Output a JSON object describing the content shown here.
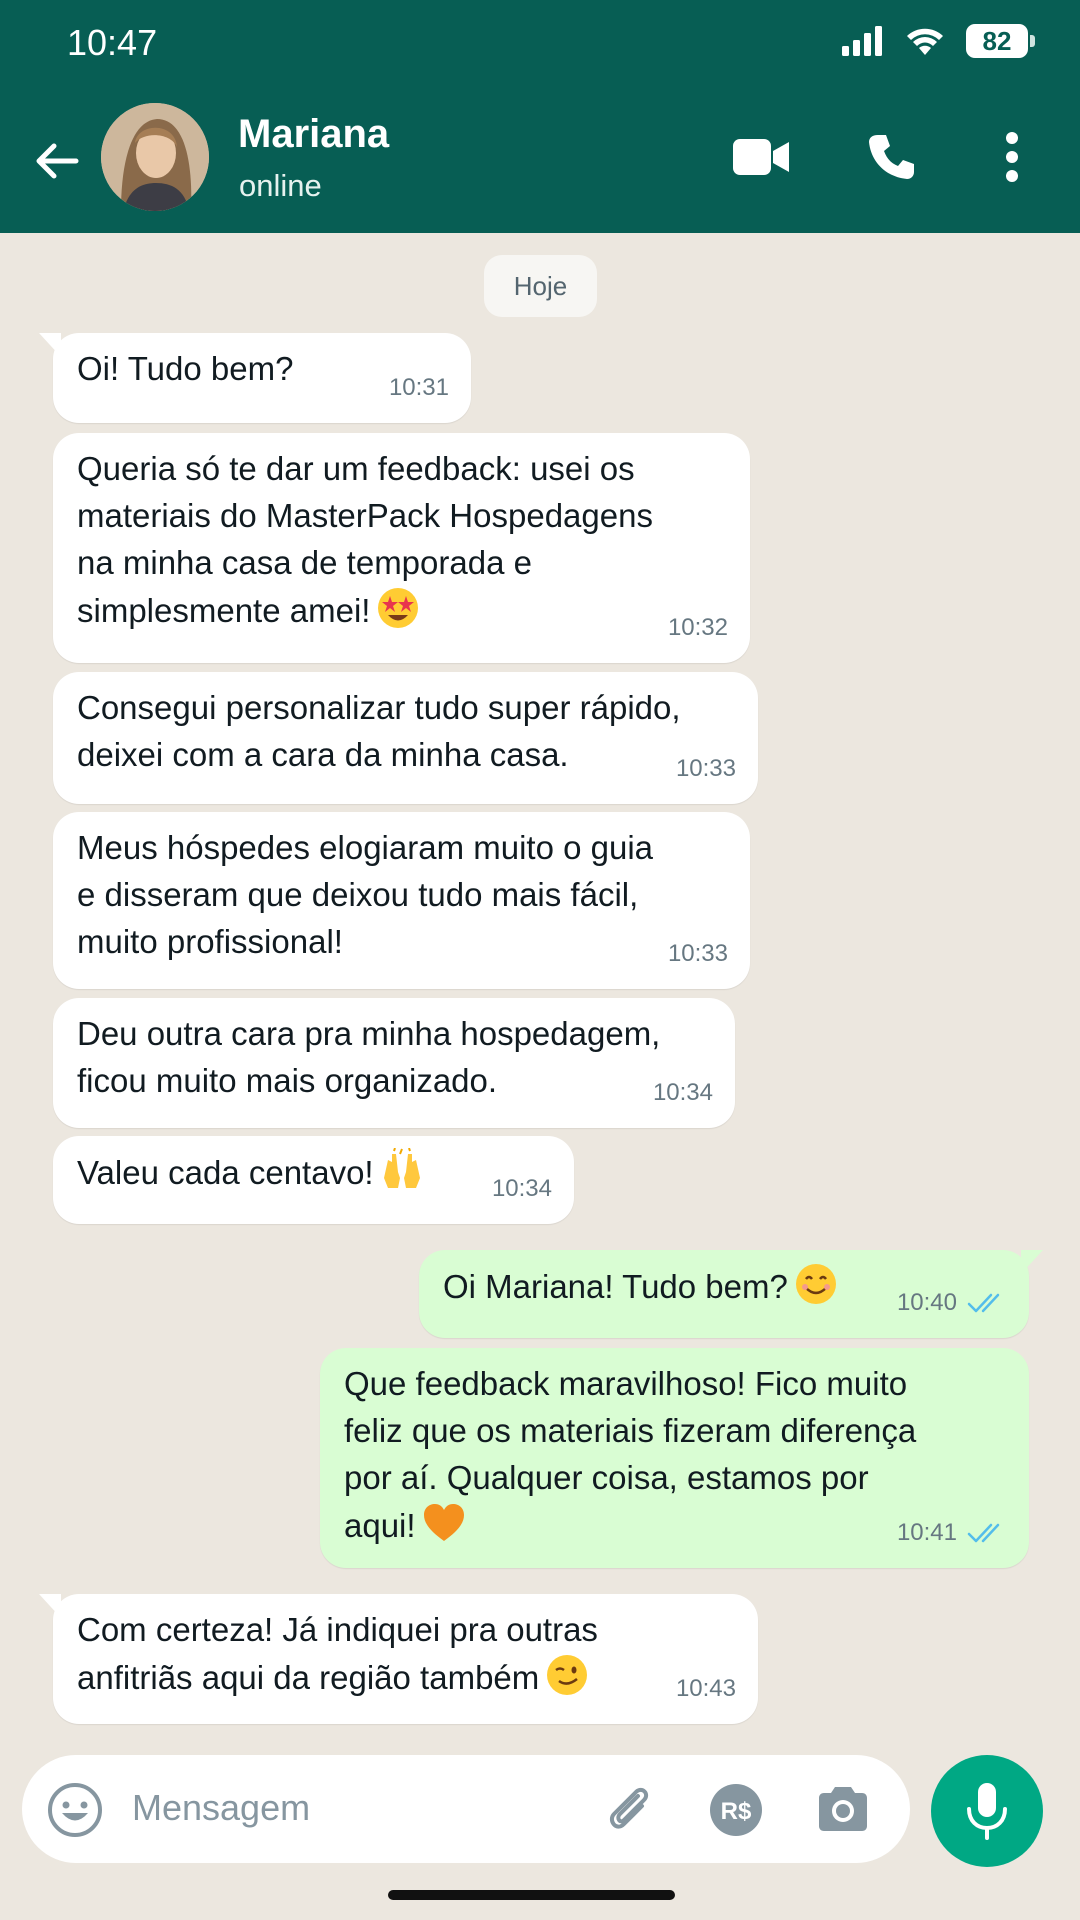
{
  "status_bar": {
    "time": "10:47",
    "battery": "82"
  },
  "header": {
    "contact_name": "Mariana",
    "contact_status": "online"
  },
  "date_chip": "Hoje",
  "messages": [
    {
      "direction": "in",
      "text": "Oi! Tudo bem?",
      "time": "10:31",
      "emoji": ""
    },
    {
      "direction": "in",
      "text": "Queria só te dar um feedback: usei os\nmateriais do MasterPack Hospedagens\nna minha casa de temporada e\nsimplesmente amei!",
      "time": "10:32",
      "emoji": "star-struck"
    },
    {
      "direction": "in",
      "text": "Consegui personalizar tudo super rápido,\ndeixei com a cara da minha casa.",
      "time": "10:33",
      "emoji": ""
    },
    {
      "direction": "in",
      "text": "Meus hóspedes elogiaram muito o guia\ne disseram que deixou tudo mais fácil,\nmuito profissional!",
      "time": "10:33",
      "emoji": ""
    },
    {
      "direction": "in",
      "text": "Deu outra cara pra minha hospedagem,\nficou muito mais organizado.",
      "time": "10:34",
      "emoji": ""
    },
    {
      "direction": "in",
      "text": "Valeu cada centavo!",
      "time": "10:34",
      "emoji": "raising-hands"
    },
    {
      "direction": "out",
      "text": "Oi Mariana! Tudo bem?",
      "time": "10:40",
      "emoji": "smiling-face",
      "read": true
    },
    {
      "direction": "out",
      "text": "Que feedback maravilhoso! Fico muito\nfeliz que os materiais fizeram diferença\npor aí. Qualquer coisa, estamos por\naqui!",
      "time": "10:41",
      "emoji": "orange-heart",
      "read": true
    },
    {
      "direction": "in",
      "text": "Com certeza! Já indiquei pra outras\nanfitriãs aqui da região também",
      "time": "10:43",
      "emoji": "winking-face"
    }
  ],
  "input": {
    "placeholder": "Mensagem"
  },
  "colors": {
    "header": "#075e54",
    "incoming_bubble": "#ffffff",
    "outgoing_bubble": "#d9fdd3",
    "read_ticks": "#53bdeb",
    "mic_button": "#00a884",
    "chat_background": "#ece7df"
  }
}
